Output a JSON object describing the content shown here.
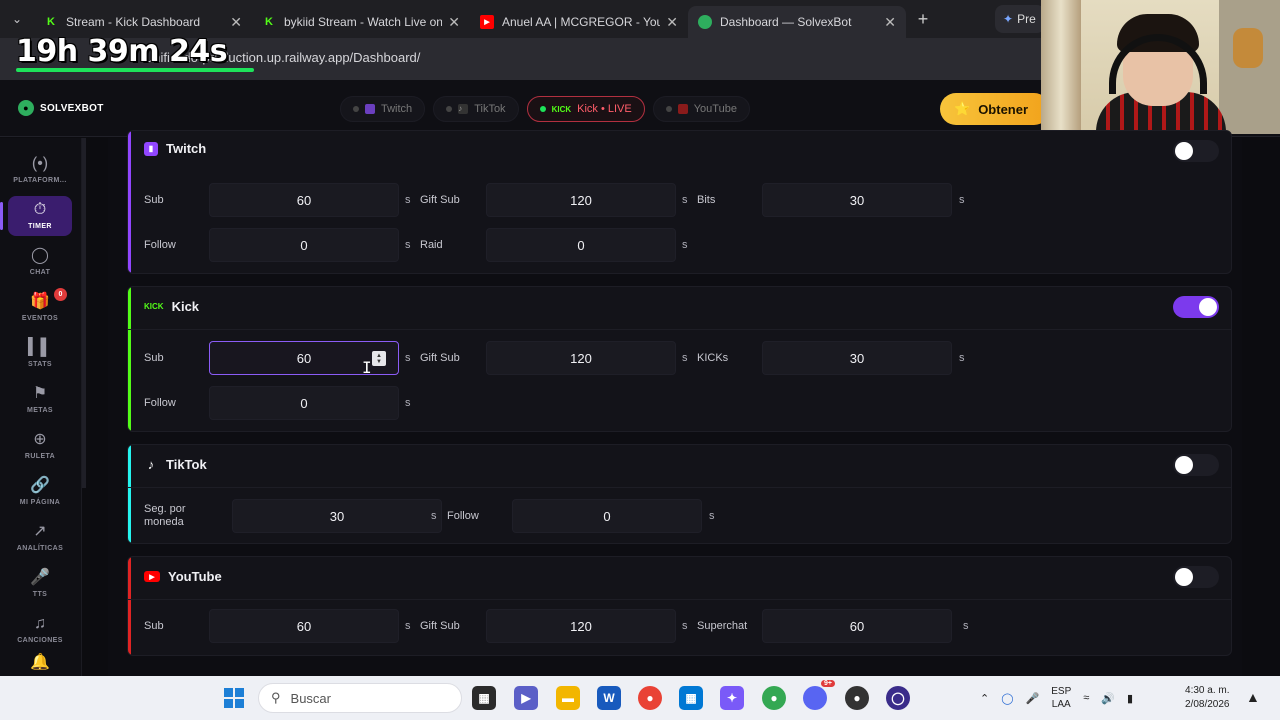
{
  "browser": {
    "tabs": [
      {
        "title": "Stream - Kick Dashboard",
        "icon": "kick-icon",
        "color": "#53fc18"
      },
      {
        "title": "bykiid Stream - Watch Live on",
        "icon": "kick-icon",
        "color": "#53fc18"
      },
      {
        "title": "Anuel AA | MCGREGOR - YouT",
        "icon": "youtube-icon",
        "color": "#ff0000"
      },
      {
        "title": "Dashboard — SolvexBot",
        "icon": "solvexbot-icon",
        "color": "#2eae5e"
      }
    ],
    "extra_tab": "Pre",
    "url": "unificado-production.up.railway.app/Dashboard/"
  },
  "overlay": {
    "stream_timer": "19h 39m 24s"
  },
  "header": {
    "logo": "SOLVEXBOT",
    "platforms": [
      {
        "label": "Twitch",
        "live": false
      },
      {
        "label": "TikTok",
        "live": false
      },
      {
        "label": "Kick • LIVE",
        "prefix": "KICK",
        "live": true
      },
      {
        "label": "YouTube",
        "live": false
      }
    ],
    "cta": "Obtener"
  },
  "sidebar": {
    "items": [
      {
        "label": "PLATAFORM...",
        "icon": "broadcast-icon"
      },
      {
        "label": "TIMER",
        "icon": "stopwatch-icon",
        "active": true
      },
      {
        "label": "CHAT",
        "icon": "chat-bubble-icon"
      },
      {
        "label": "EVENTOS",
        "icon": "gift-icon",
        "badge": "0"
      },
      {
        "label": "STATS",
        "icon": "bar-chart-icon"
      },
      {
        "label": "METAS",
        "icon": "flag-icon"
      },
      {
        "label": "RULETA",
        "icon": "roulette-icon"
      },
      {
        "label": "MI PÁGINA",
        "icon": "link-icon"
      },
      {
        "label": "ANALÍTICAS",
        "icon": "trend-icon"
      },
      {
        "label": "TTS",
        "icon": "microphone-icon"
      },
      {
        "label": "CANCIONES",
        "icon": "music-note-icon"
      }
    ]
  },
  "cards": {
    "twitch": {
      "title": "Twitch",
      "enabled": false,
      "accent": "#9146ff",
      "fields": {
        "sub": {
          "label": "Sub",
          "value": "60"
        },
        "gift_sub": {
          "label": "Gift Sub",
          "value": "120"
        },
        "bits": {
          "label": "Bits",
          "value": "30"
        },
        "follow": {
          "label": "Follow",
          "value": "0"
        },
        "raid": {
          "label": "Raid",
          "value": "0"
        }
      }
    },
    "kick": {
      "title": "Kick",
      "badge": "KICK",
      "enabled": true,
      "accent": "#53fc18",
      "fields": {
        "sub": {
          "label": "Sub",
          "value": "60"
        },
        "gift_sub": {
          "label": "Gift Sub",
          "value": "120"
        },
        "kicks": {
          "label": "KICKs",
          "value": "30"
        },
        "follow": {
          "label": "Follow",
          "value": "0"
        }
      }
    },
    "tiktok": {
      "title": "TikTok",
      "enabled": false,
      "accent": "#25f4ee",
      "fields": {
        "seg_por_moneda": {
          "label_line1": "Seg. por",
          "label_line2": "moneda",
          "value": "30"
        },
        "follow": {
          "label": "Follow",
          "value": "0"
        }
      }
    },
    "youtube": {
      "title": "YouTube",
      "enabled": false,
      "accent": "#ff0000",
      "fields": {
        "sub": {
          "label": "Sub",
          "value": "60"
        },
        "gift_sub": {
          "label": "Gift Sub",
          "value": "120"
        },
        "superchat": {
          "label": "Superchat",
          "value": "60"
        }
      }
    },
    "unit": "s"
  },
  "taskbar": {
    "search_placeholder": "Buscar",
    "notification_count": "9+",
    "lang_line1": "ESP",
    "lang_line2": "LAA",
    "time": "4:30 a. m.",
    "date": "2/08/2026"
  }
}
